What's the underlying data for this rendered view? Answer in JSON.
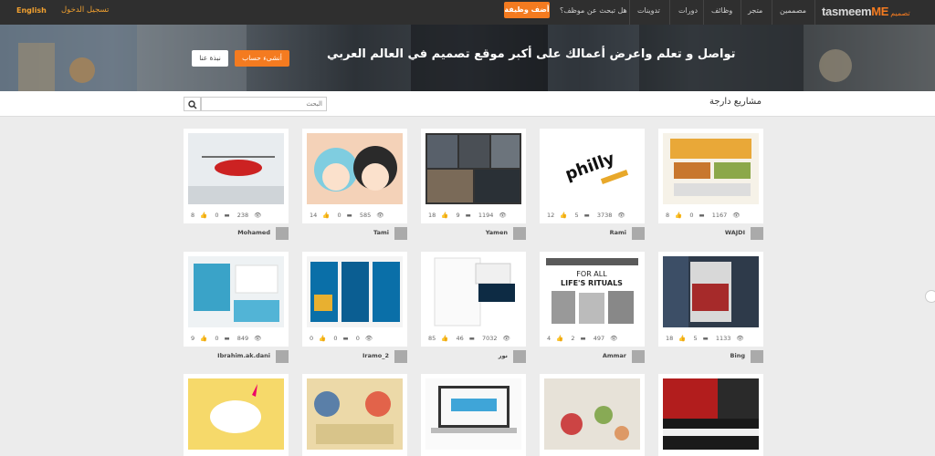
{
  "header": {
    "logo_main": "tasmeem",
    "logo_accent": "ME",
    "logo_arabic": "تصميم",
    "language": "English",
    "login": "تسجيل الدخول",
    "add_job": "أضف وظيفة",
    "nav": [
      "مصممين",
      "متجر",
      "وظائف",
      "دورات",
      "تدوينات",
      "هل تبحث عن موظف؟"
    ]
  },
  "hero": {
    "title": "تواصل و تعلم واعرض أعمالك على أكبر موقع تصميم في العالم العربي",
    "signup": "أنشىء حساب",
    "about": "نبذة عنا"
  },
  "section": {
    "title": "مشاريع دارجة",
    "search_placeholder": "البحث"
  },
  "cards": [
    {
      "likes": "8",
      "comments": "0",
      "views": "1167",
      "author": "WAJDI",
      "thumb": "food"
    },
    {
      "likes": "12",
      "comments": "5",
      "views": "3738",
      "author": "Rami",
      "thumb": "philly"
    },
    {
      "likes": "18",
      "comments": "9",
      "views": "1194",
      "author": "Yamen",
      "thumb": "grid"
    },
    {
      "likes": "14",
      "comments": "0",
      "views": "585",
      "author": "Tami",
      "thumb": "anime"
    },
    {
      "likes": "8",
      "comments": "0",
      "views": "238",
      "author": "Mohamed",
      "thumb": "heli"
    },
    {
      "likes": "18",
      "comments": "5",
      "views": "1133",
      "author": "Bing",
      "thumb": "assassin"
    },
    {
      "likes": "4",
      "comments": "2",
      "views": "497",
      "author": "Ammar",
      "thumb": "magazine",
      "thumb_title": "FOR ALL LIFE'S RITUALS"
    },
    {
      "likes": "85",
      "comments": "46",
      "views": "7032",
      "author": "نور",
      "thumb": "stationery"
    },
    {
      "likes": "0",
      "comments": "0",
      "views": "0",
      "author": "Iramo_2",
      "thumb": "blueposters"
    },
    {
      "likes": "9",
      "comments": "0",
      "views": "849",
      "author": "Ibrahim.ak.dani",
      "thumb": "branding"
    },
    {
      "thumb": "redsite"
    },
    {
      "thumb": "fabric"
    },
    {
      "thumb": "laptop"
    },
    {
      "thumb": "infographic"
    },
    {
      "thumb": "unicorn"
    }
  ],
  "colors": {
    "accent": "#f47b20",
    "nav_bg": "#2f2f2f",
    "page_bg": "#ececec"
  }
}
